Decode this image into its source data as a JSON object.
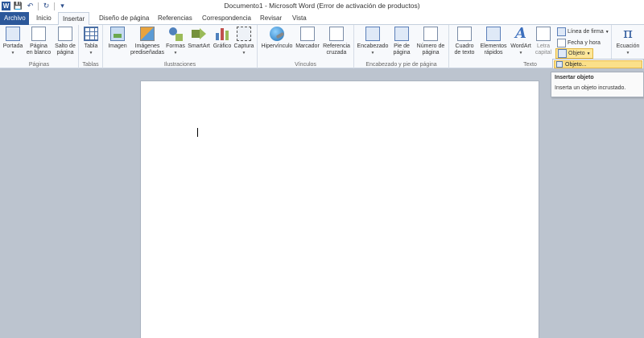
{
  "window": {
    "title": "Documento1 - Microsoft Word (Error de activación de productos)"
  },
  "qat": {
    "logo": "W",
    "save_icon": "save-icon",
    "undo_icon": "undo-icon",
    "redo_icon": "redo-icon"
  },
  "tabs": {
    "file": "Archivo",
    "items": [
      "Inicio",
      "Insertar",
      "Diseño de página",
      "Referencias",
      "Correspondencia",
      "Revisar",
      "Vista"
    ],
    "active": "Insertar"
  },
  "ribbon": {
    "groups": {
      "paginas": "Páginas",
      "tablas": "Tablas",
      "ilustraciones": "Ilustraciones",
      "vinculos": "Vínculos",
      "encabezado": "Encabezado y pie de página",
      "texto": "Texto"
    },
    "buttons": {
      "portada_1": "Portada",
      "pagina_blanco_1": "Página",
      "pagina_blanco_2": "en blanco",
      "salto_1": "Salto de",
      "salto_2": "página",
      "tabla": "Tabla",
      "imagen": "Imagen",
      "imagenes_1": "Imágenes",
      "imagenes_2": "prediseñadas",
      "formas": "Formas",
      "smartart": "SmartArt",
      "grafico": "Gráfico",
      "captura": "Captura",
      "hipervinculo": "Hipervínculo",
      "marcador": "Marcador",
      "referencia_1": "Referencia",
      "referencia_2": "cruzada",
      "encabezado": "Encabezado",
      "pie_1": "Pie de",
      "pie_2": "página",
      "numero_1": "Número de",
      "numero_2": "página",
      "cuadro_1": "Cuadro",
      "cuadro_2": "de texto",
      "elementos_1": "Elementos",
      "elementos_2": "rápidos",
      "wordart": "WordArt",
      "letra_1": "Letra",
      "letra_2": "capital",
      "linea_firma": "Línea de firma",
      "fecha_hora": "Fecha y hora",
      "objeto": "Objeto",
      "ecuacion": "Ecuación"
    }
  },
  "dropdown": {
    "item": "Objeto..."
  },
  "tooltip": {
    "title": "Insertar objeto",
    "body": "Inserta un objeto incrustado."
  }
}
